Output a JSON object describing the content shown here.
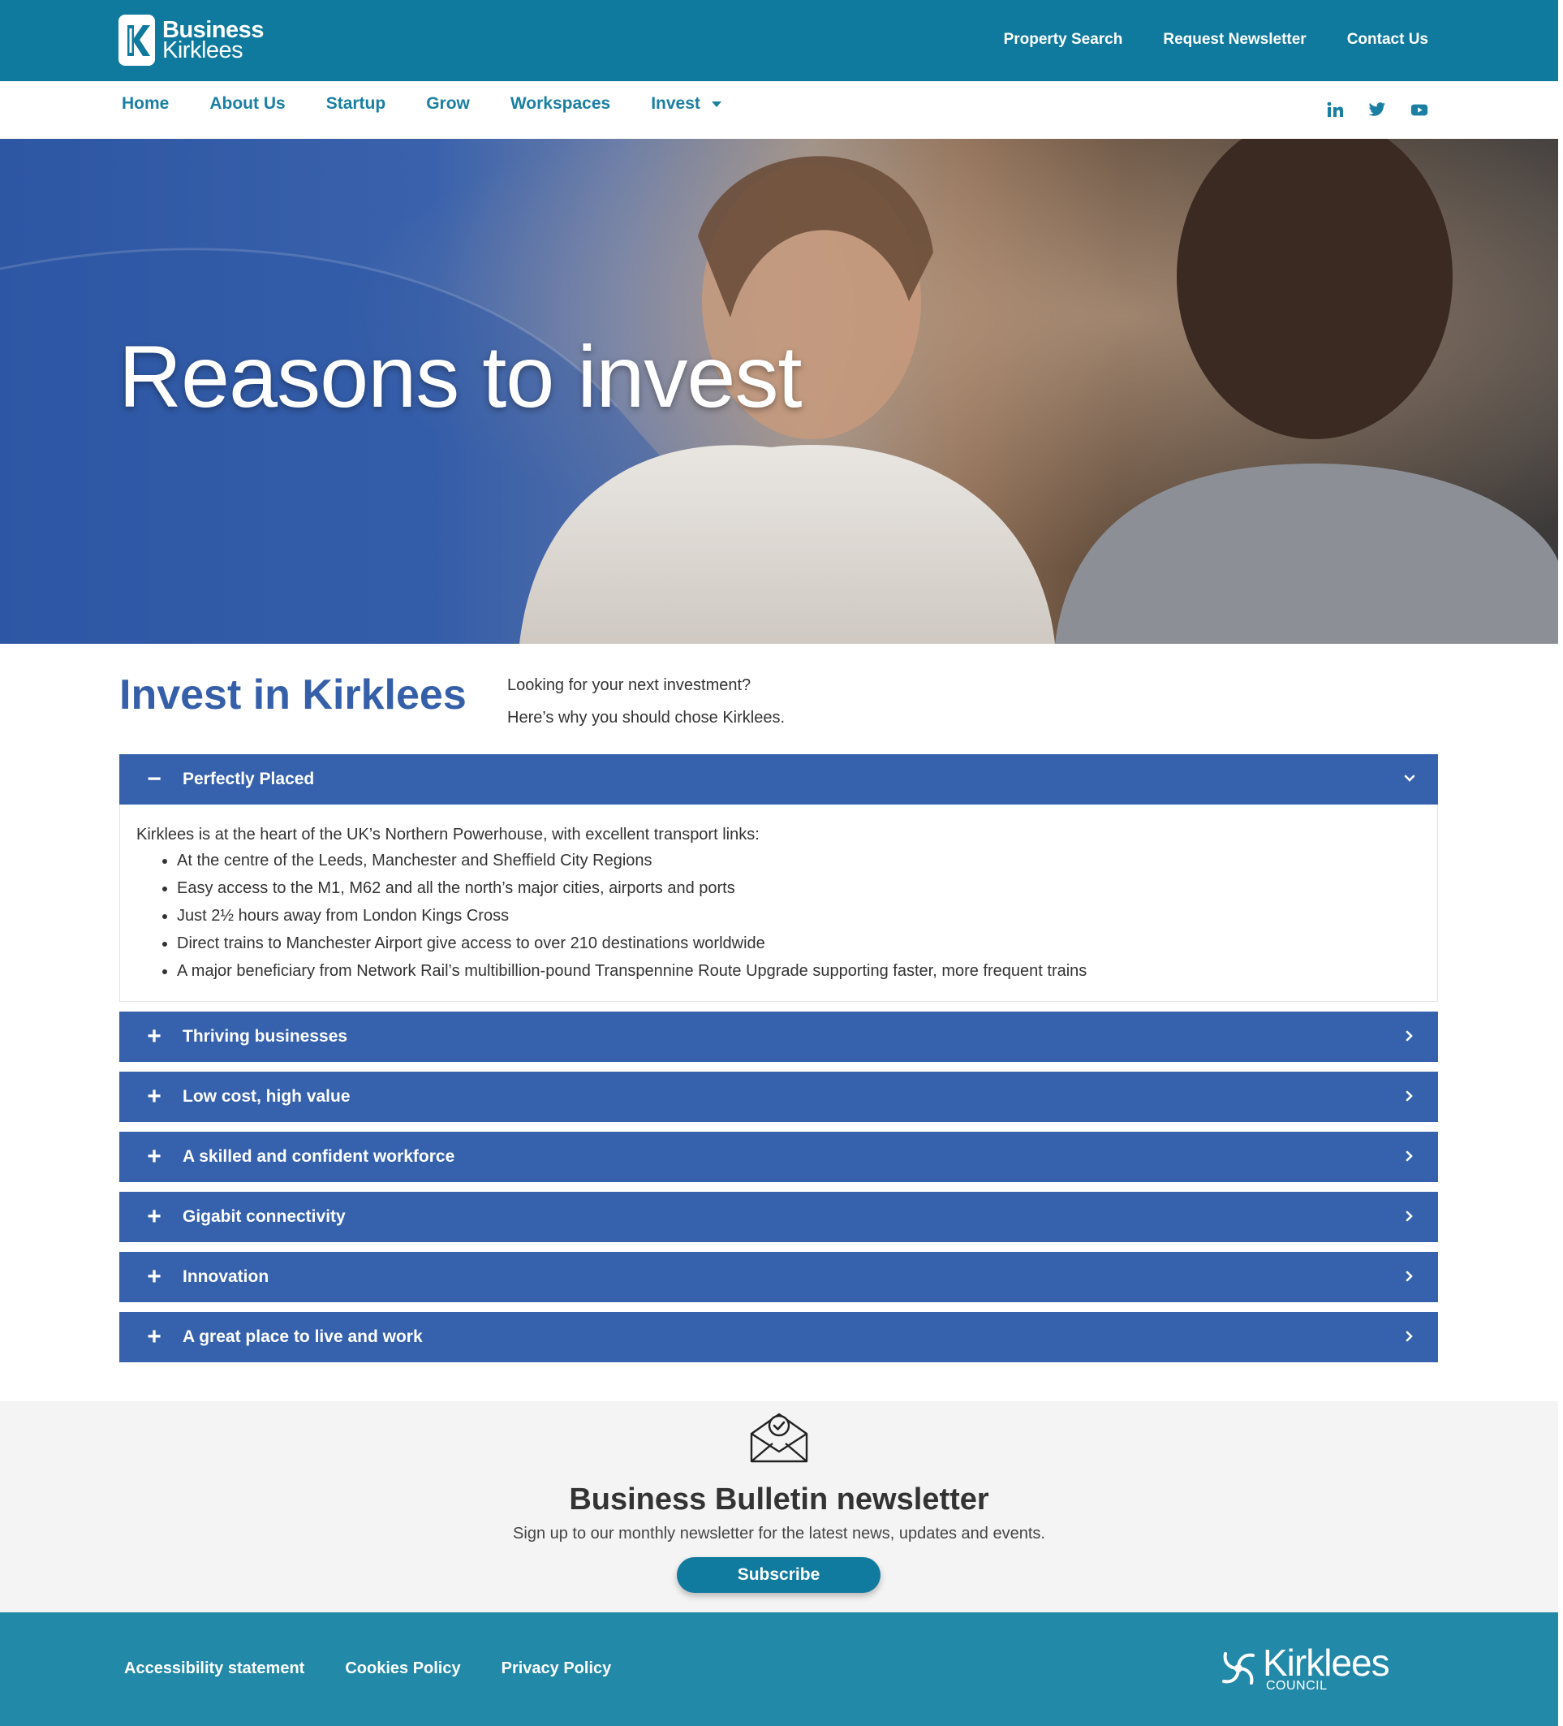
{
  "brand": {
    "line1": "Business",
    "line2": "Kirklees",
    "primary_color": "#0f7a9e",
    "accent_color": "#3561ad"
  },
  "top_links": [
    "Property Search",
    "Request Newsletter",
    "Contact Us"
  ],
  "nav": {
    "items": [
      "Home",
      "About Us",
      "Startup",
      "Grow",
      "Workspaces",
      "Invest"
    ],
    "social_icons": [
      "linkedin-icon",
      "twitter-icon",
      "youtube-icon"
    ]
  },
  "hero": {
    "title": "Reasons to invest"
  },
  "intro": {
    "heading": "Invest in Kirklees",
    "line1": "Looking for your next investment?",
    "line2": "Here’s why you should chose Kirklees."
  },
  "accordion": {
    "open": {
      "label": "Perfectly Placed",
      "intro": "Kirklees is at the heart of the UK’s Northern Powerhouse, with excellent transport links:",
      "bullets": [
        "At the centre of the Leeds, Manchester and Sheffield City Regions",
        "Easy access to the M1, M62 and all the north’s major cities, airports and ports",
        "Just 2½ hours away from London Kings Cross",
        "Direct trains to Manchester Airport give access to over 210 destinations worldwide",
        "A major beneficiary from Network Rail’s multibillion-pound Transpennine Route Upgrade supporting faster, more frequent trains"
      ]
    },
    "closed": [
      "Thriving businesses",
      "Low cost, high value",
      "A skilled and confident workforce",
      "Gigabit connectivity",
      "Innovation",
      "A great place to live and work"
    ]
  },
  "newsletter": {
    "title": "Business Bulletin newsletter",
    "subtitle": "Sign up to our monthly newsletter for the latest news, updates and events.",
    "button": "Subscribe"
  },
  "footer": {
    "links": [
      "Accessibility statement",
      "Cookies Policy",
      "Privacy Policy"
    ],
    "council_name": "Kirklees",
    "council_sub": "COUNCIL"
  }
}
